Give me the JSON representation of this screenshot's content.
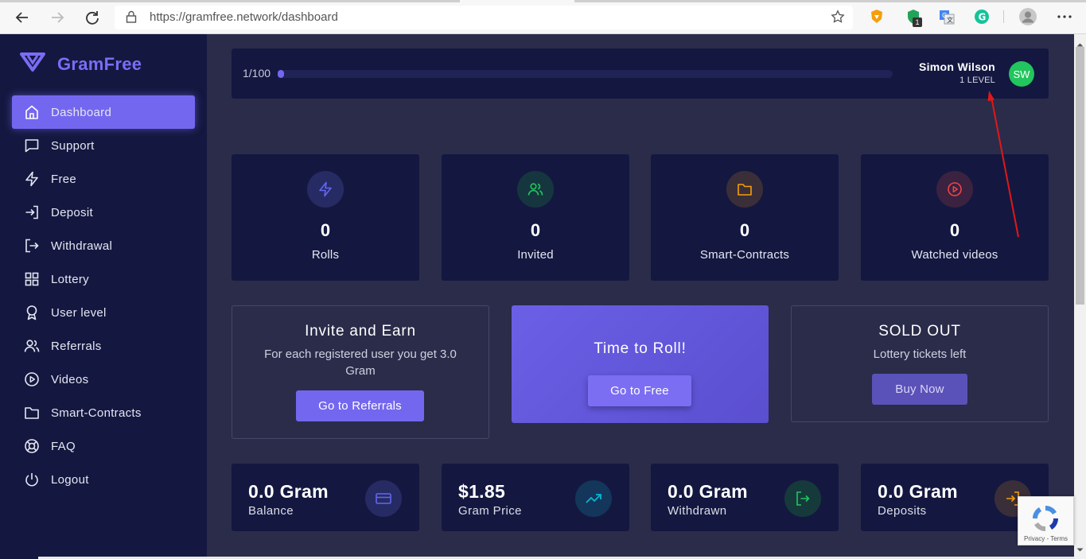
{
  "browser": {
    "url": "https://gramfree.network/dashboard",
    "extension_badge": "1"
  },
  "sidebar": {
    "brand": "GramFree",
    "items": [
      {
        "label": "Dashboard",
        "icon": "home-icon",
        "active": true
      },
      {
        "label": "Support",
        "icon": "chat-icon"
      },
      {
        "label": "Free",
        "icon": "lightning-icon"
      },
      {
        "label": "Deposit",
        "icon": "login-icon"
      },
      {
        "label": "Withdrawal",
        "icon": "logout-arrow-icon"
      },
      {
        "label": "Lottery",
        "icon": "grid-icon"
      },
      {
        "label": "User level",
        "icon": "award-icon"
      },
      {
        "label": "Referrals",
        "icon": "users-icon"
      },
      {
        "label": "Videos",
        "icon": "play-circle-icon"
      },
      {
        "label": "Smart-Contracts",
        "icon": "folder-icon"
      },
      {
        "label": "FAQ",
        "icon": "lifebuoy-icon"
      },
      {
        "label": "Logout",
        "icon": "power-icon"
      }
    ]
  },
  "topbar": {
    "progress_label": "1/100",
    "progress_value": 0.01,
    "user_name": "Simon Wilson",
    "user_level": "1 LEVEL",
    "avatar_initials": "SW"
  },
  "stats": [
    {
      "value": "0",
      "label": "Rolls",
      "icon": "lightning-icon",
      "color": "#6366f1"
    },
    {
      "value": "0",
      "label": "Invited",
      "icon": "users-icon",
      "color": "#22c55e"
    },
    {
      "value": "0",
      "label": "Smart-Contracts",
      "icon": "folder-icon",
      "color": "#f59e0b"
    },
    {
      "value": "0",
      "label": "Watched videos",
      "icon": "play-circle-icon",
      "color": "#ef4444"
    }
  ],
  "cards": {
    "invite": {
      "title": "Invite and Earn",
      "subtitle": "For each registered user you get 3.0 Gram",
      "button": "Go to Referrals"
    },
    "roll": {
      "title": "Time to Roll!",
      "button": "Go to Free"
    },
    "lottery": {
      "title": "SOLD OUT",
      "subtitle": "Lottery tickets left",
      "button": "Buy Now"
    }
  },
  "balances": [
    {
      "value": "0.0 Gram",
      "label": "Balance",
      "icon": "credit-card-icon",
      "color": "#6366f1"
    },
    {
      "value": "$1.85",
      "label": "Gram Price",
      "icon": "trending-up-icon",
      "color": "#06b6d4"
    },
    {
      "value": "0.0 Gram",
      "label": "Withdrawn",
      "icon": "logout-arrow-icon",
      "color": "#22c55e"
    },
    {
      "value": "0.0 Gram",
      "label": "Deposits",
      "icon": "login-icon",
      "color": "#f59e0b"
    }
  ],
  "recaptcha": {
    "text": "Privacy - Terms"
  }
}
